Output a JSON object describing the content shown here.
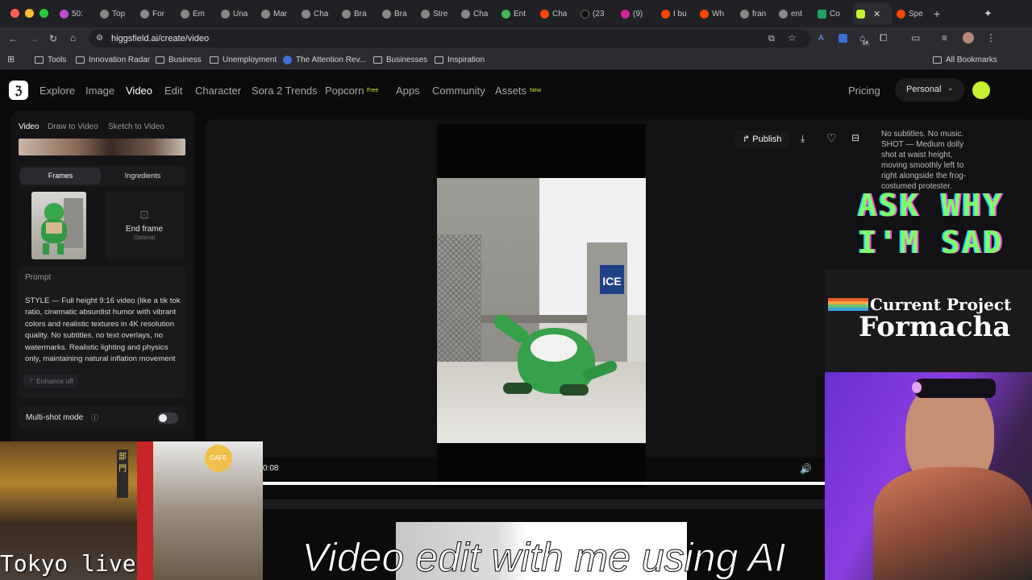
{
  "browser": {
    "tabs": [
      "50:",
      "Top",
      "For",
      "Em",
      "Una",
      "Mar",
      "Cha",
      "Bra",
      "Bra",
      "Stre",
      "Cha",
      "Ent",
      "Cha",
      "(23",
      "(9)",
      "I bu",
      "Wh",
      "fran",
      "ent",
      "Co",
      "",
      "Spe"
    ],
    "url": "higgsfield.ai/create/video",
    "bookmarks": [
      "Tools",
      "Innovation Radar",
      "Business",
      "Unemployment",
      "The Attention Rev...",
      "Businesses",
      "Inspiration"
    ],
    "all_bookmarks": "All Bookmarks",
    "extension_badge": "14"
  },
  "nav": {
    "items": [
      "Explore",
      "Image",
      "Video",
      "Edit",
      "Character",
      "Sora 2 Trends",
      "Popcorn",
      "Apps",
      "Community",
      "Assets"
    ],
    "popcorn_badge": "Free",
    "assets_badge": "New",
    "pricing": "Pricing",
    "workspace": "Personal"
  },
  "panel": {
    "modes": [
      "Video",
      "Draw to Video",
      "Sketch to Video"
    ],
    "toggle": [
      "Frames",
      "Ingredients"
    ],
    "end_frame": "End frame",
    "end_frame_hint": "Optional",
    "prompt_label": "Prompt",
    "prompt_text": "STYLE — Full height 9:16 video (like a tik tok ratio, cinematic absurdist humor with vibrant colors and realistic textures in 4K resolution quality. No subtitles, no text overlays, no watermarks. Realistic lighting and physics only, maintaining natural inflation movement and fabric",
    "enhance": "Enhance off",
    "multishot": "Multi-shot mode"
  },
  "viewer": {
    "publish": "Publish",
    "sign_text": "ICE",
    "time": "0:08",
    "progress": 1.0,
    "side_text": "No subtitles. No music. SHOT — Medium dolly shot at waist height, moving smoothly left to right alongside the frog-costumed protester."
  },
  "overlays": {
    "ask": "ASK WHY I'M SAD",
    "project_label": "Current Project",
    "project_name": "Formacha",
    "tokyo": "Tokyo live",
    "caption": "Video edit with me using AI",
    "cafe": "CAFE"
  },
  "colors": {
    "accent": "#c7f02e",
    "bg": "#0b0b0c",
    "neon_green": "#7dff6a"
  }
}
